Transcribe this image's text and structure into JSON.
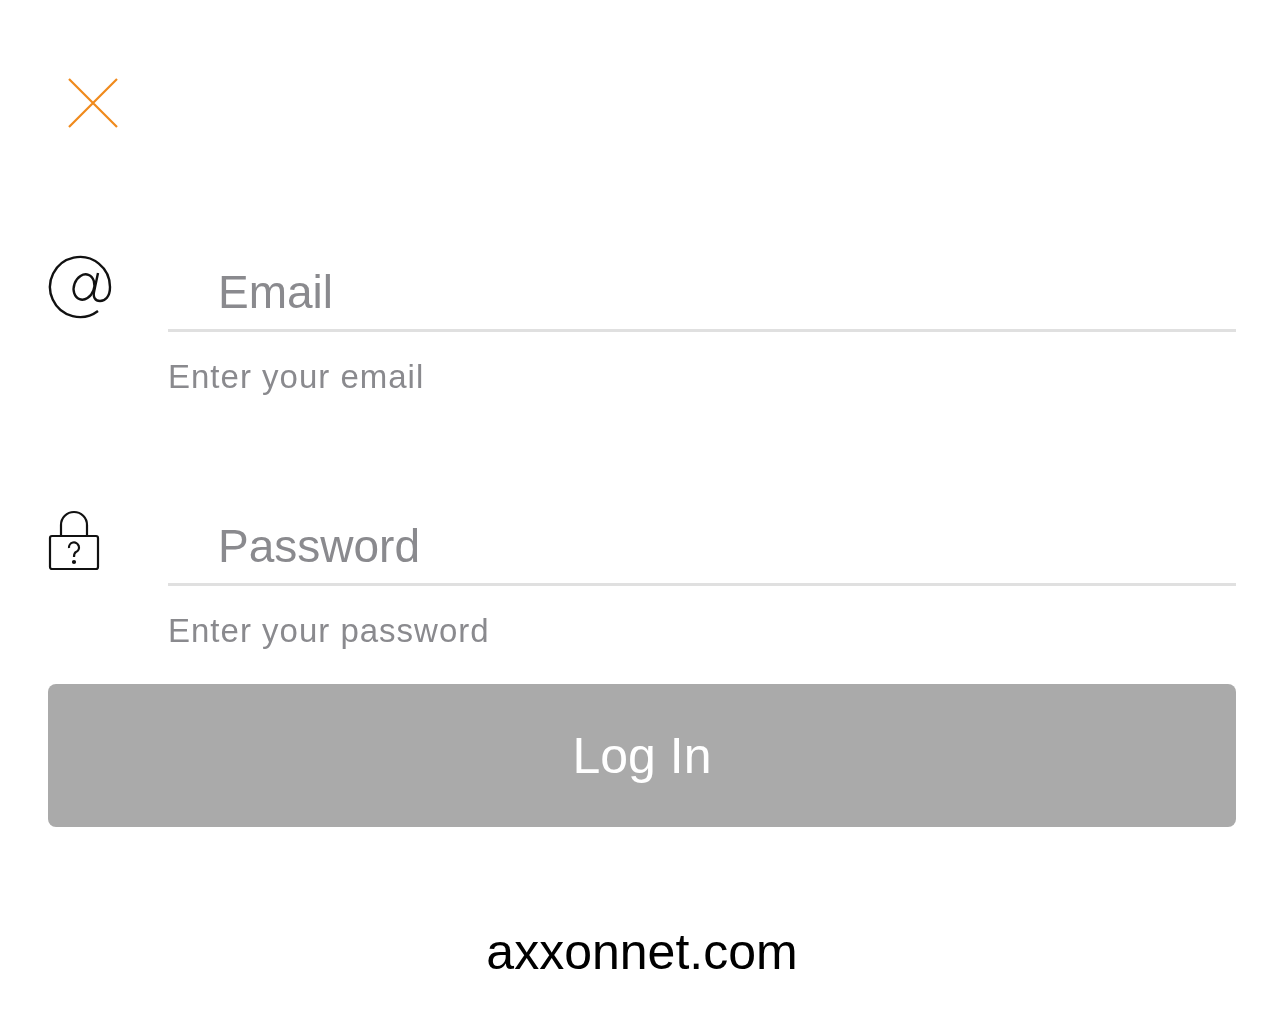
{
  "fields": [
    {
      "kind": "email",
      "placeholder": "Email",
      "hint": "Enter your email"
    },
    {
      "kind": "password",
      "placeholder": "Password",
      "hint": "Enter your password"
    }
  ],
  "login_button": {
    "label": "Log In",
    "disabled": true
  },
  "footer_link": "axxonnet.com"
}
